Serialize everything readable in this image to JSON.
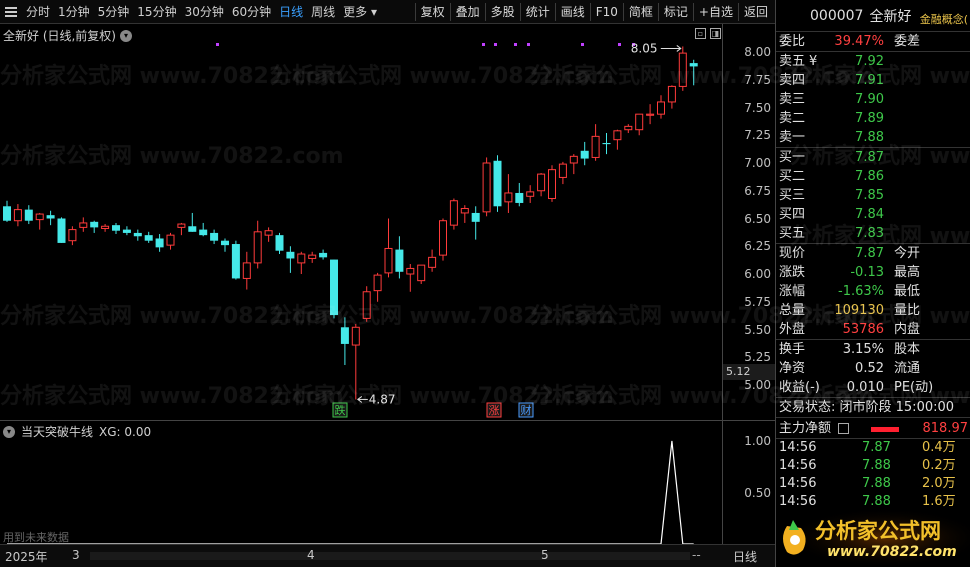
{
  "toolbar": {
    "periods": [
      "分时",
      "1分钟",
      "5分钟",
      "15分钟",
      "30分钟",
      "60分钟",
      "日线",
      "周线",
      "更多"
    ],
    "active_period": "日线",
    "buttons": [
      "复权",
      "叠加",
      "多股",
      "统计",
      "画线",
      "F10",
      "简框",
      "标记",
      "+自选",
      "返回"
    ]
  },
  "main_chart": {
    "title": "全新好 (日线,前复权)",
    "high_label": "8.05",
    "low_label": "4.87",
    "markers": [
      {
        "text": "跌",
        "color": "#3ec84a"
      },
      {
        "text": "涨",
        "color": "#ff4040"
      },
      {
        "text": "财",
        "color": "#4a9cff"
      }
    ],
    "current_price_tag": "5.12",
    "price_ticks": [
      "8.00",
      "7.75",
      "7.50",
      "7.25",
      "7.00",
      "6.75",
      "6.50",
      "6.25",
      "6.00",
      "5.75",
      "5.50",
      "5.25",
      "5.00"
    ]
  },
  "sub_chart": {
    "title": "当天突破牛线",
    "xg_label": "XG: 0.00",
    "ticks": [
      "1.00",
      "0.50"
    ],
    "note": "用到未来数据"
  },
  "date_bar": {
    "year": "2025年",
    "months": [
      "3",
      "4",
      "5"
    ],
    "dash": "--",
    "period": "日线"
  },
  "right_panel": {
    "code": "000007",
    "name": "全新好",
    "concept": "金融概念(",
    "weibi_label": "委比",
    "weibi_value": "39.47%",
    "weicha_label": "委差",
    "asks": [
      {
        "label": "卖五",
        "price": "7.92",
        "flag": "¥"
      },
      {
        "label": "卖四",
        "price": "7.91"
      },
      {
        "label": "卖三",
        "price": "7.90"
      },
      {
        "label": "卖二",
        "price": "7.89"
      },
      {
        "label": "卖一",
        "price": "7.88"
      }
    ],
    "bids": [
      {
        "label": "买一",
        "price": "7.87"
      },
      {
        "label": "买二",
        "price": "7.86"
      },
      {
        "label": "买三",
        "price": "7.85"
      },
      {
        "label": "买四",
        "price": "7.84"
      },
      {
        "label": "买五",
        "price": "7.83"
      }
    ],
    "quote": [
      {
        "l1": "现价",
        "v1": "7.87",
        "c1": "green",
        "l2": "今开",
        "v2": ""
      },
      {
        "l1": "涨跌",
        "v1": "-0.13",
        "c1": "green",
        "l2": "最高",
        "v2": ""
      },
      {
        "l1": "涨幅",
        "v1": "-1.63%",
        "c1": "green",
        "l2": "最低",
        "v2": ""
      },
      {
        "l1": "总量",
        "v1": "109130",
        "c1": "yellow",
        "l2": "量比",
        "v2": ""
      },
      {
        "l1": "外盘",
        "v1": "53786",
        "c1": "red",
        "l2": "内盘",
        "v2": ""
      }
    ],
    "fin": [
      {
        "l1": "换手",
        "v1": "3.15%",
        "l2": "股本"
      },
      {
        "l1": "净资",
        "v1": "0.52",
        "l2": "流通"
      },
      {
        "l1": "收益(-)",
        "v1": "0.010",
        "l2": "PE(动)"
      }
    ],
    "trade_status": "交易状态: 闭市阶段 15:00:00",
    "main_force_label": "主力净额",
    "main_force_value": "818.97",
    "ticks": [
      {
        "time": "14:56",
        "price": "7.87",
        "vol": "0.4万"
      },
      {
        "time": "14:56",
        "price": "7.88",
        "vol": "0.2万"
      },
      {
        "time": "14:56",
        "price": "7.88",
        "vol": "2.0万"
      },
      {
        "time": "14:56",
        "price": "7.88",
        "vol": "1.6万"
      }
    ]
  },
  "watermark": "分析家公式网 www.70822.com",
  "logo": {
    "title": "分析家公式网",
    "url": "www.70822.com"
  },
  "candles": [
    [
      6.61,
      6.66,
      6.47,
      6.48
    ],
    [
      6.48,
      6.63,
      6.43,
      6.58
    ],
    [
      6.58,
      6.62,
      6.45,
      6.48
    ],
    [
      6.49,
      6.55,
      6.4,
      6.54
    ],
    [
      6.53,
      6.57,
      6.44,
      6.5
    ],
    [
      6.5,
      6.51,
      6.28,
      6.28
    ],
    [
      6.3,
      6.43,
      6.26,
      6.4
    ],
    [
      6.42,
      6.51,
      6.38,
      6.46
    ],
    [
      6.47,
      6.48,
      6.37,
      6.42
    ],
    [
      6.41,
      6.45,
      6.38,
      6.43
    ],
    [
      6.44,
      6.46,
      6.36,
      6.39
    ],
    [
      6.4,
      6.43,
      6.35,
      6.37
    ],
    [
      6.37,
      6.4,
      6.3,
      6.34
    ],
    [
      6.35,
      6.38,
      6.28,
      6.3
    ],
    [
      6.32,
      6.36,
      6.2,
      6.24
    ],
    [
      6.26,
      6.37,
      6.22,
      6.35
    ],
    [
      6.42,
      6.46,
      6.35,
      6.45
    ],
    [
      6.43,
      6.55,
      6.38,
      6.38
    ],
    [
      6.4,
      6.46,
      6.34,
      6.35
    ],
    [
      6.37,
      6.4,
      6.27,
      6.3
    ],
    [
      6.3,
      6.32,
      6.2,
      6.26
    ],
    [
      6.27,
      6.3,
      5.95,
      5.96
    ],
    [
      5.96,
      6.2,
      5.86,
      6.1
    ],
    [
      6.1,
      6.48,
      6.05,
      6.38
    ],
    [
      6.35,
      6.42,
      6.29,
      6.39
    ],
    [
      6.35,
      6.37,
      6.18,
      6.21
    ],
    [
      6.2,
      6.25,
      6.01,
      6.14
    ],
    [
      6.1,
      6.2,
      6.0,
      6.18
    ],
    [
      6.14,
      6.2,
      6.1,
      6.17
    ],
    [
      6.19,
      6.22,
      6.13,
      6.15
    ],
    [
      6.13,
      6.13,
      5.6,
      5.63
    ],
    [
      5.52,
      5.61,
      5.18,
      5.37
    ],
    [
      5.36,
      5.55,
      4.87,
      5.52
    ],
    [
      5.6,
      5.89,
      5.57,
      5.84
    ],
    [
      5.85,
      6.01,
      5.75,
      5.99
    ],
    [
      6.01,
      6.5,
      5.97,
      6.23
    ],
    [
      6.22,
      6.34,
      5.96,
      6.02
    ],
    [
      6.0,
      6.09,
      5.84,
      6.05
    ],
    [
      5.94,
      6.04,
      5.91,
      6.08
    ],
    [
      6.06,
      6.22,
      6.02,
      6.15
    ],
    [
      6.17,
      6.5,
      6.12,
      6.48
    ],
    [
      6.44,
      6.68,
      6.4,
      6.66
    ],
    [
      6.55,
      6.62,
      6.46,
      6.59
    ],
    [
      6.55,
      6.61,
      6.31,
      6.47
    ],
    [
      6.56,
      7.05,
      6.52,
      7.0
    ],
    [
      7.02,
      7.07,
      6.56,
      6.61
    ],
    [
      6.65,
      6.9,
      6.55,
      6.73
    ],
    [
      6.73,
      6.82,
      6.61,
      6.64
    ],
    [
      6.7,
      6.8,
      6.64,
      6.74
    ],
    [
      6.75,
      6.91,
      6.7,
      6.9
    ],
    [
      6.68,
      6.98,
      6.65,
      6.94
    ],
    [
      6.87,
      7.01,
      6.81,
      6.99
    ],
    [
      7.0,
      7.08,
      6.9,
      7.06
    ],
    [
      7.11,
      7.19,
      6.98,
      7.04
    ],
    [
      7.05,
      7.35,
      7.02,
      7.24
    ],
    [
      7.18,
      7.27,
      7.08,
      7.17
    ],
    [
      7.21,
      7.3,
      7.12,
      7.29
    ],
    [
      7.3,
      7.35,
      7.27,
      7.33
    ],
    [
      7.3,
      7.39,
      7.25,
      7.44
    ],
    [
      7.43,
      7.53,
      7.35,
      7.44
    ],
    [
      7.44,
      7.61,
      7.4,
      7.55
    ],
    [
      7.55,
      7.7,
      7.49,
      7.69
    ],
    [
      7.69,
      8.05,
      7.65,
      7.99
    ],
    [
      7.9,
      7.93,
      7.7,
      7.87
    ]
  ],
  "signal_values": [
    0,
    0,
    0,
    0,
    0,
    0,
    0,
    0,
    0,
    0,
    0,
    0,
    0,
    0,
    0,
    0,
    0,
    0,
    0,
    0,
    0,
    0,
    0,
    0,
    0,
    0,
    0,
    0,
    0,
    0,
    0,
    0,
    0,
    0,
    0,
    0,
    0,
    0,
    0,
    0,
    0,
    0,
    0,
    0,
    0,
    0,
    0,
    0,
    0,
    0,
    0,
    0,
    0,
    0,
    0,
    0,
    0,
    0,
    0,
    0,
    0,
    1,
    0,
    0
  ],
  "colors": {
    "up": "#ff3b3b",
    "down": "#45e8e8",
    "signal_line": "#ffffff",
    "accent": "#3aa0ff"
  }
}
